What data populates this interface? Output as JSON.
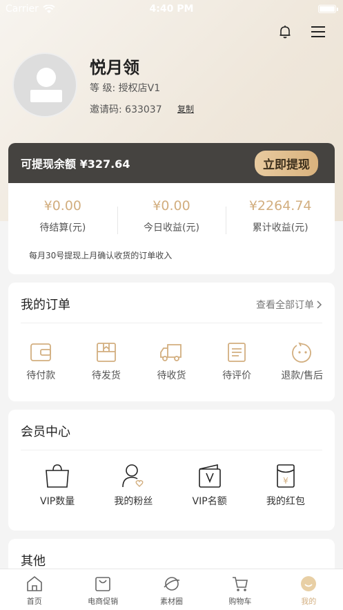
{
  "status_bar": {
    "carrier": "Carrier",
    "time": "4:40 PM"
  },
  "profile": {
    "name": "悦月领",
    "level": "等 级: 授权店V1",
    "invite": "邀请码: 633037",
    "copy_label": "复制"
  },
  "balance": {
    "label": "可提现余额 ¥327.64",
    "withdraw_label": "立即提现",
    "stats": [
      {
        "value": "¥0.00",
        "label": "待结算(元)"
      },
      {
        "value": "¥0.00",
        "label": "今日收益(元)"
      },
      {
        "value": "¥2264.74",
        "label": "累计收益(元)"
      }
    ],
    "tip": "每月30号提现上月确认收货的订单收入"
  },
  "orders": {
    "title": "我的订单",
    "see_all": "查看全部订单",
    "items": [
      {
        "label": "待付款",
        "icon": "wallet-icon"
      },
      {
        "label": "待发货",
        "icon": "package-icon"
      },
      {
        "label": "待收货",
        "icon": "truck-icon"
      },
      {
        "label": "待评价",
        "icon": "review-icon"
      },
      {
        "label": "退款/售后",
        "icon": "refund-icon"
      }
    ]
  },
  "member": {
    "title": "会员中心",
    "items": [
      {
        "label": "VIP数量",
        "icon": "bag-icon"
      },
      {
        "label": "我的粉丝",
        "icon": "fans-icon"
      },
      {
        "label": "VIP名额",
        "icon": "vip-icon"
      },
      {
        "label": "我的红包",
        "icon": "red-packet-icon"
      }
    ]
  },
  "other": {
    "title": "其他"
  },
  "tabbar": {
    "items": [
      {
        "label": "首页",
        "icon": "home-icon"
      },
      {
        "label": "电商促销",
        "icon": "shop-bag-icon"
      },
      {
        "label": "素材圈",
        "icon": "planet-icon"
      },
      {
        "label": "购物车",
        "icon": "cart-icon"
      },
      {
        "label": "我的",
        "icon": "profile-icon"
      }
    ],
    "active": "我的"
  },
  "colors": {
    "accent": "#d2ae7f",
    "dark_header": "#454340"
  }
}
